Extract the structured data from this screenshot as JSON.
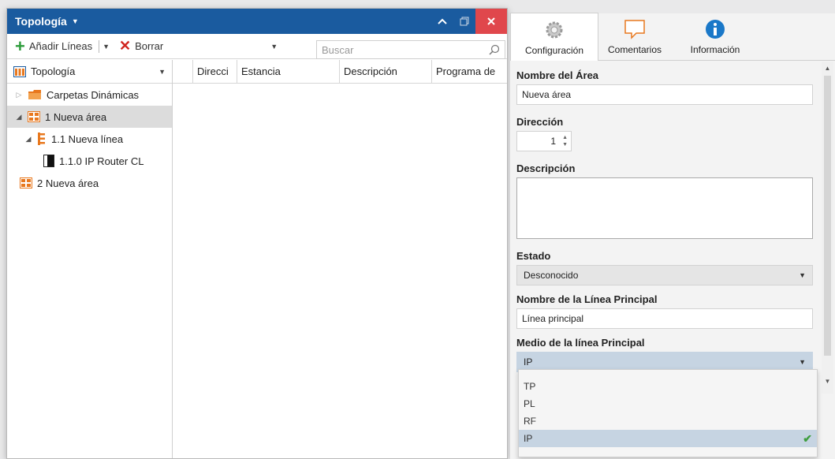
{
  "window": {
    "title": "Topología",
    "title_icon": "dropdown-triangle",
    "controls": [
      "^",
      "❐",
      "✕"
    ]
  },
  "toolbar": {
    "add_label": "Añadir Líneas",
    "delete_label": "Borrar",
    "search_placeholder": "Buscar"
  },
  "tree": {
    "header": "Topología",
    "nodes": [
      {
        "label": "Carpetas Dinámicas",
        "icon": "folder-icon",
        "level": 0,
        "expander": "▷"
      },
      {
        "label": "1 Nueva área",
        "icon": "area-icon",
        "level": 0,
        "expander": "◢",
        "selected": true
      },
      {
        "label": "1.1 Nueva línea",
        "icon": "line-icon",
        "level": 1,
        "expander": "◢"
      },
      {
        "label": "1.1.0 IP Router CL",
        "icon": "device-icon",
        "level": 2,
        "expander": ""
      },
      {
        "label": "2 Nueva área",
        "icon": "area-icon",
        "level": 0,
        "expander": ""
      }
    ]
  },
  "grid": {
    "columns": [
      "Direcci",
      "Estancia",
      "Descripción",
      "Programa de"
    ]
  },
  "props": {
    "tabs": [
      {
        "label": "Configuración",
        "icon": "gear-icon",
        "active": true
      },
      {
        "label": "Comentarios",
        "icon": "comment-icon",
        "active": false
      },
      {
        "label": "Información",
        "icon": "info-icon",
        "active": false
      }
    ],
    "area_name_label": "Nombre del Área",
    "area_name_value": "Nueva área",
    "address_label": "Dirección",
    "address_value": "1",
    "description_label": "Descripción",
    "state_label": "Estado",
    "state_value": "Desconocido",
    "main_line_name_label": "Nombre de la Línea Principal",
    "main_line_name_value": "Línea principal",
    "main_line_medium_label": "Medio de la línea Principal",
    "main_line_medium_value": "IP"
  },
  "dropdown": {
    "options": [
      "TP",
      "PL",
      "RF",
      "IP"
    ],
    "selected": "IP"
  },
  "colors": {
    "titlebar": "#1a5b9f",
    "close": "#e0474c",
    "accent_orange": "#e8781e",
    "highlight": "#c6d4e2"
  }
}
